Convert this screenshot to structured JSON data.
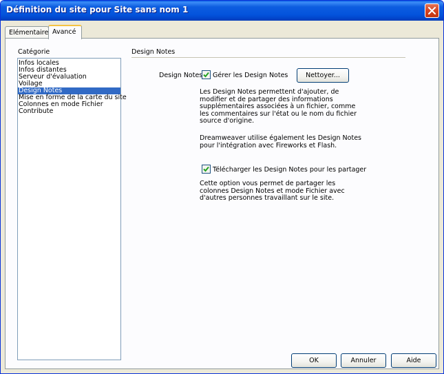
{
  "window": {
    "title": "Définition du site pour Site sans nom 1"
  },
  "tabs": [
    {
      "label": "Elémentaire"
    },
    {
      "label": "Avancé"
    }
  ],
  "sidebar": {
    "label": "Catégorie",
    "items": [
      {
        "label": "Infos locales"
      },
      {
        "label": "Infos distantes"
      },
      {
        "label": "Serveur d'évaluation"
      },
      {
        "label": "Voilage"
      },
      {
        "label": "Design Notes"
      },
      {
        "label": "Mise en forme de la carte du site"
      },
      {
        "label": "Colonnes en mode Fichier"
      },
      {
        "label": "Contribute"
      }
    ],
    "selected": "Design Notes"
  },
  "section": {
    "title": "Design Notes",
    "field_label": "Design Notes :",
    "manage_checkbox": {
      "label": "Gérer les Design Notes",
      "checked": true
    },
    "clean_button": "Nettoyer...",
    "desc1": "Les Design Notes permettent d'ajouter, de modifier et de partager des informations supplémentaires associées à un fichier, comme les commentaires sur l'état ou le nom du fichier source d'origine.",
    "desc2": "Dreamweaver utilise également les Design Notes pour l'intégration avec Fireworks et Flash.",
    "upload_checkbox": {
      "label": "Télécharger les Design Notes pour les partager",
      "checked": true
    },
    "desc3": "Cette option vous permet de partager les colonnes Design Notes et mode Fichier avec d'autres personnes travaillant sur le site."
  },
  "buttons": {
    "ok": "OK",
    "cancel": "Annuler",
    "help": "Aide"
  },
  "colors": {
    "titlebar": "#0353dc",
    "selection": "#316ac5",
    "window_bg": "#ece9d8",
    "tab_highlight": "#f5c342"
  },
  "icons": {
    "close": "close-icon",
    "check": "checkmark-icon"
  }
}
